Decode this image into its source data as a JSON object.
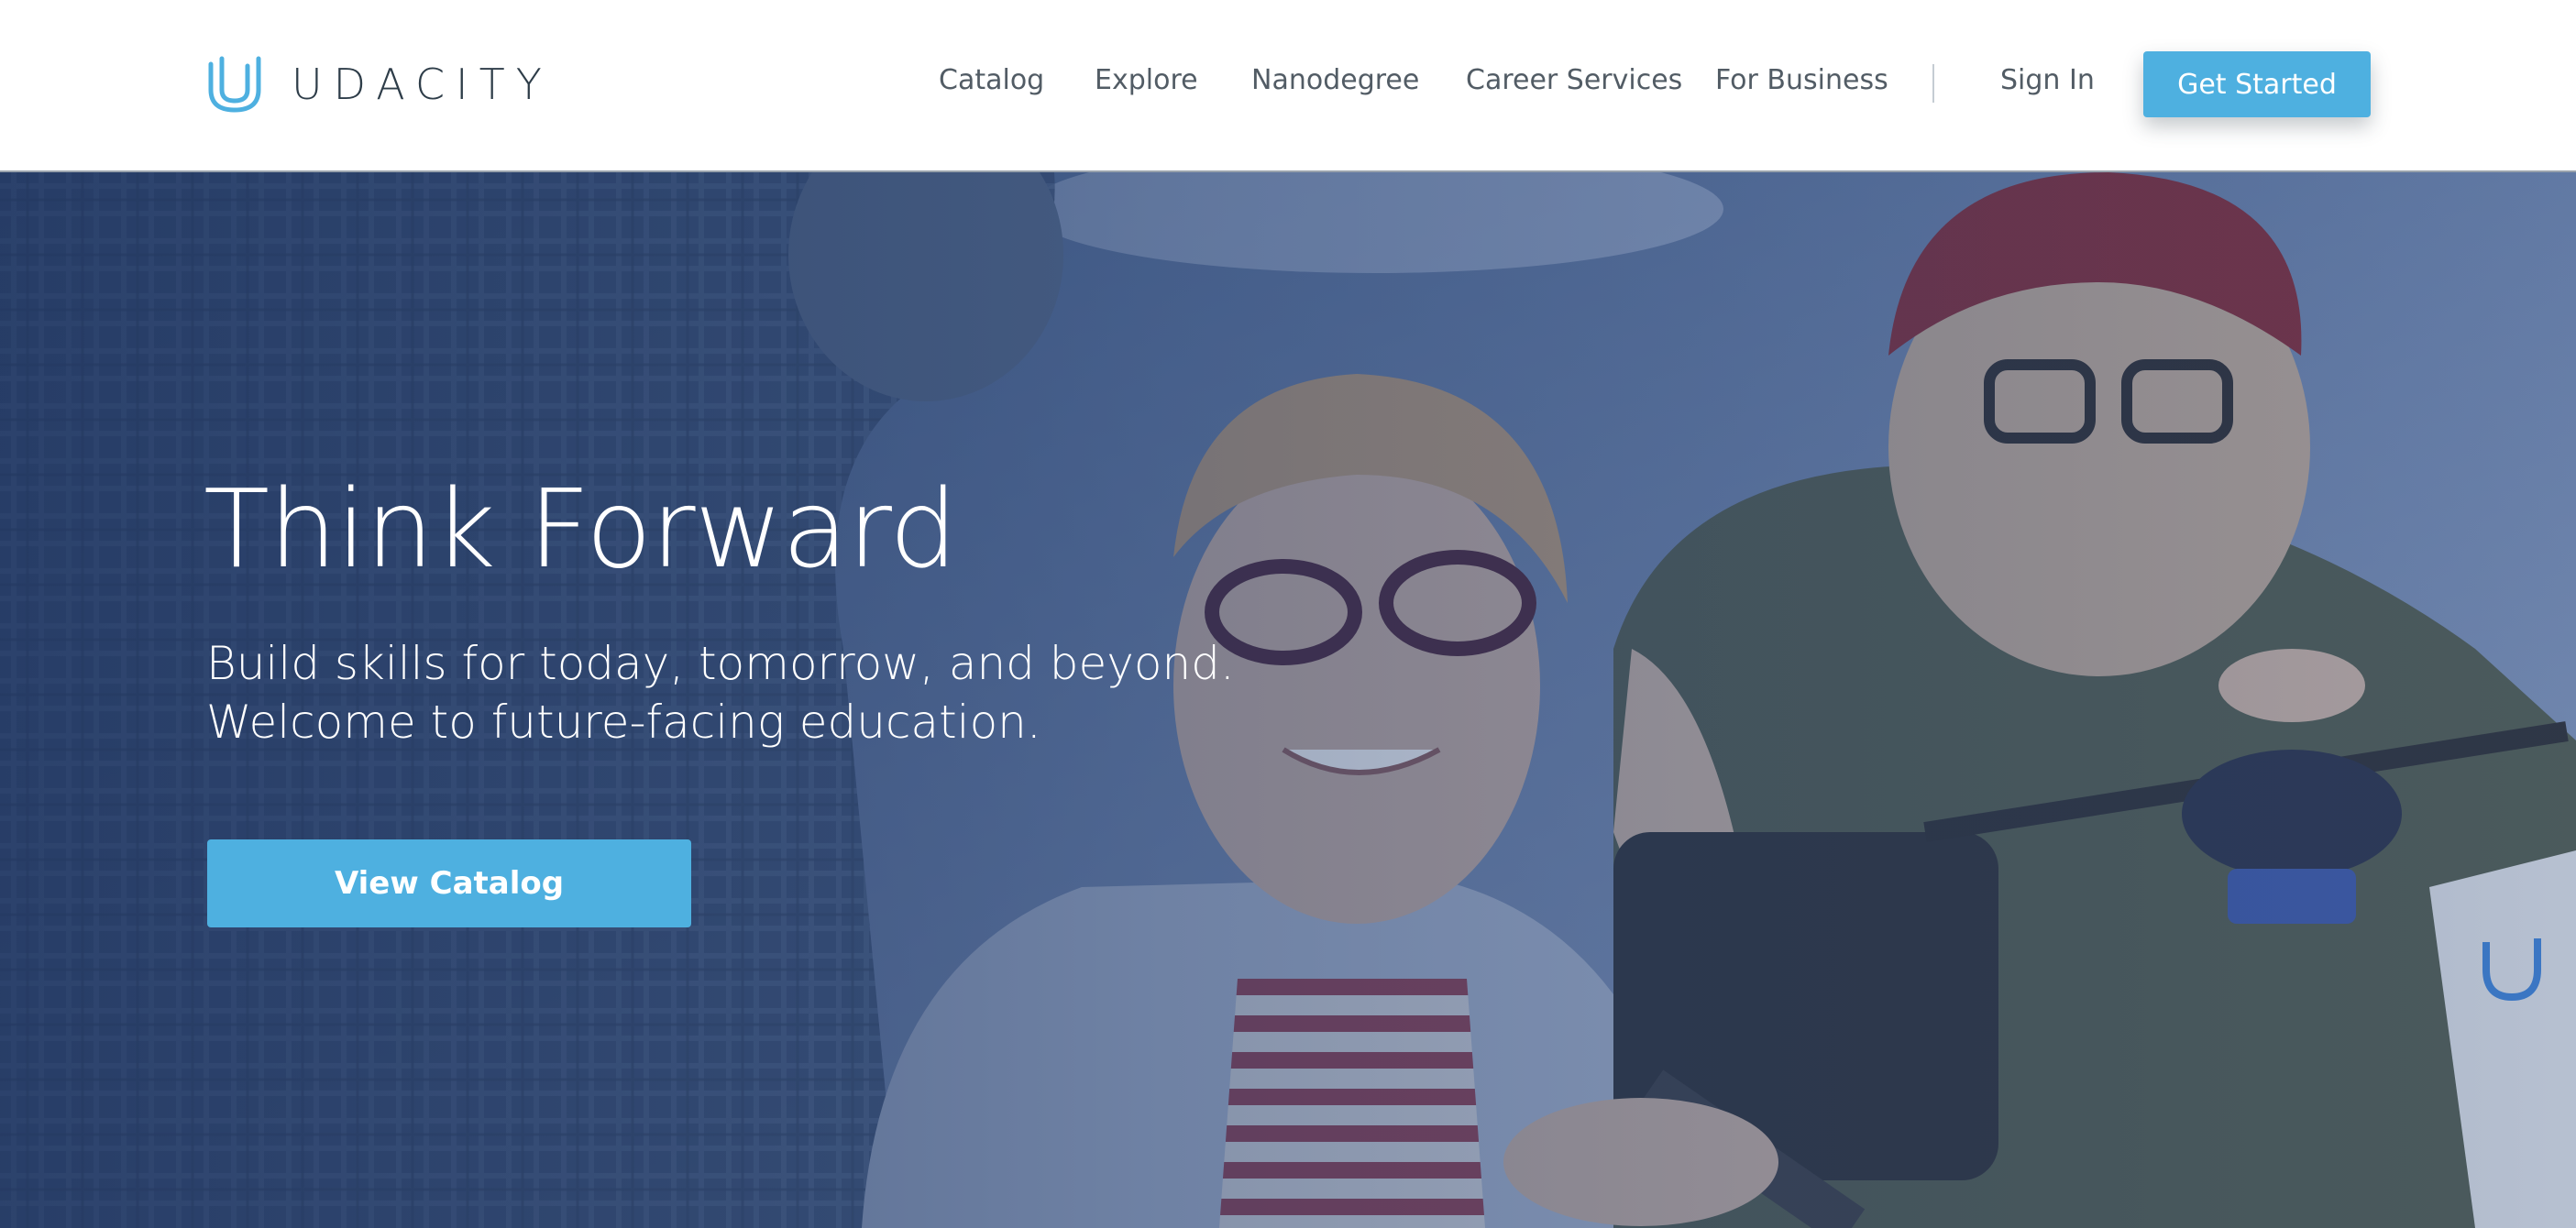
{
  "brand": {
    "name": "UDACITY",
    "accent_color": "#4eb0e0",
    "text_color": "#2e3d49",
    "logo_icon": "udacity-u-icon"
  },
  "nav": {
    "items": [
      {
        "label": "Catalog"
      },
      {
        "label": "Explore"
      },
      {
        "label": "Nanodegree"
      },
      {
        "label": "Career Services"
      },
      {
        "label": "For Business"
      }
    ],
    "sign_in": "Sign In",
    "get_started": "Get Started"
  },
  "hero": {
    "title": "Think Forward",
    "subtitle_lines": [
      "Build skills for today, tomorrow, and beyond.",
      "Welcome to future-facing education."
    ],
    "cta_label": "View Catalog",
    "overlay_color": "#2a4676"
  }
}
